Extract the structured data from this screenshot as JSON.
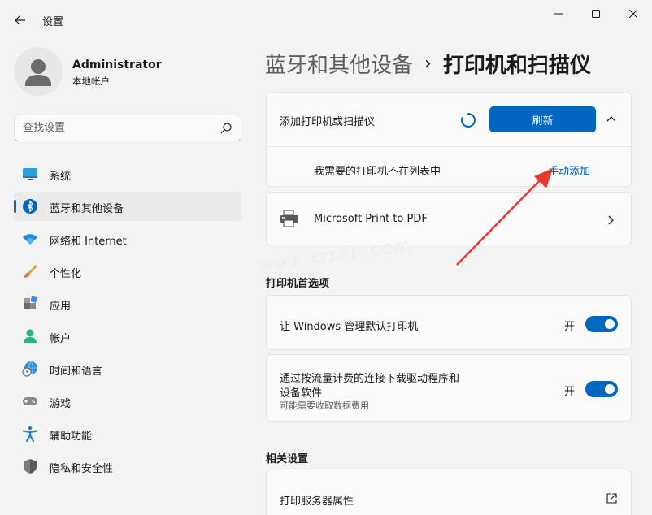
{
  "app": {
    "title": "设置"
  },
  "profile": {
    "name": "Administrator",
    "account_type": "本地帐户"
  },
  "search": {
    "placeholder": "查找设置"
  },
  "nav": {
    "items": [
      {
        "label": "系统",
        "icon": "monitor-icon"
      },
      {
        "label": "蓝牙和其他设备",
        "icon": "bluetooth-icon",
        "active": true
      },
      {
        "label": "网络和 Internet",
        "icon": "wifi-icon"
      },
      {
        "label": "个性化",
        "icon": "brush-icon"
      },
      {
        "label": "应用",
        "icon": "apps-icon"
      },
      {
        "label": "帐户",
        "icon": "person-icon"
      },
      {
        "label": "时间和语言",
        "icon": "globe-clock-icon"
      },
      {
        "label": "游戏",
        "icon": "gamepad-icon"
      },
      {
        "label": "辅助功能",
        "icon": "accessibility-icon"
      },
      {
        "label": "隐私和安全性",
        "icon": "shield-icon"
      }
    ]
  },
  "breadcrumb": {
    "parent": "蓝牙和其他设备",
    "separator": "›",
    "current": "打印机和扫描仪"
  },
  "add_printer": {
    "title": "添加打印机或扫描仪",
    "refresh_label": "刷新",
    "missing_text": "我需要的打印机不在列表中",
    "manual_add_label": "手动添加"
  },
  "printers": [
    {
      "name": "Microsoft Print to PDF"
    }
  ],
  "preferences": {
    "section_title": "打印机首选项",
    "items": [
      {
        "label": "让 Windows 管理默认打印机",
        "state": "开",
        "on": true
      },
      {
        "label_line1": "通过按流量计费的连接下载驱动程序和",
        "label_line2": "设备软件",
        "subtext": "可能需要收取数据费用",
        "state": "开",
        "on": true
      }
    ]
  },
  "related": {
    "section_title": "相关设置",
    "items": [
      {
        "label": "打印服务器属性"
      }
    ]
  },
  "watermark": "www.kmdn.com",
  "colors": {
    "accent": "#0067c0",
    "background": "#f3f3f3",
    "card": "#fbfbfb",
    "arrow": "#e8392c"
  }
}
